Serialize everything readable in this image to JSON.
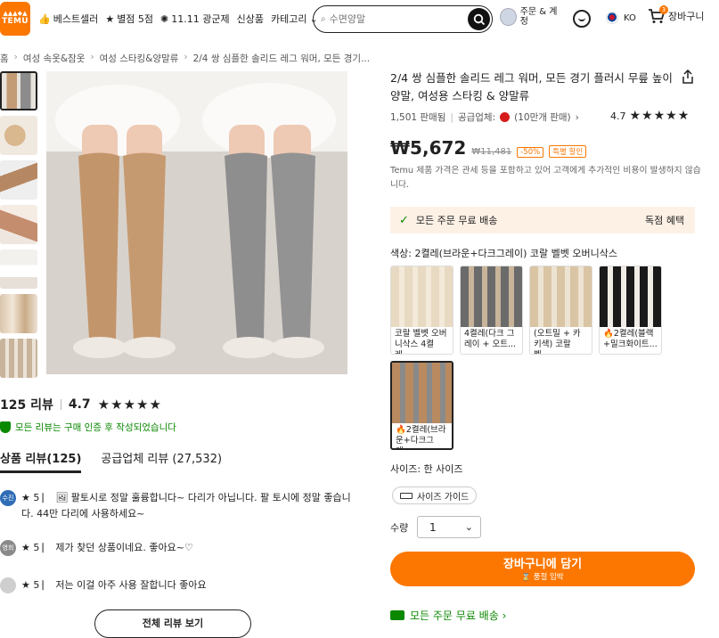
{
  "header": {
    "logo_line1": "▲▲▲◆▲",
    "logo_line2": "TEMU",
    "nav": [
      {
        "icon": "thumbs-up-icon",
        "glyph": "👍",
        "label": "베스트셀러"
      },
      {
        "icon": "star-badge-icon",
        "glyph": "★",
        "label": "별점 5점"
      },
      {
        "icon": "firework-icon",
        "glyph": "✺",
        "label": "11.11 광군제"
      },
      {
        "icon": "",
        "glyph": "",
        "label": "신상품"
      },
      {
        "icon": "chevron-down-icon",
        "glyph": "⌄",
        "label": "카테고리"
      }
    ],
    "search_placeholder": "수면양말",
    "account_label": "주문 & 계정",
    "lang": "KO",
    "cart_label": "장바구니",
    "cart_count": "3"
  },
  "breadcrumb": [
    "홈",
    "여성 속옷&잠옷",
    "여성 스타킹&양말류",
    "2/4 쌍 심플한 솔리드 레그 워머, 모든 경기..."
  ],
  "reviews": {
    "count_label": "125 리뷰",
    "rating": "4.7",
    "stars": "★★★★★",
    "verified": "모든 리뷰는 구매 인증 후 작성되었습니다",
    "tabs": [
      "상품 리뷰(125)",
      "공급업체 리뷰 (27,532)"
    ],
    "items": [
      {
        "avatar": "수진",
        "avatar_color": "#2f6db5",
        "text": "★ 5 ⎸ 🖼 팔토시로 정말 훌륭합니다~ 다리가 아닙니다. 팔 토시에 정말 좋습니다. 44만 다리에 사용하세요~"
      },
      {
        "avatar": "영희",
        "avatar_color": "#8a8a8a",
        "text": "★ 5 ⎸ 제가 찾던 상품이네요. 좋아요~♡"
      },
      {
        "avatar": "",
        "avatar_color": "#cfcfcf",
        "text": "★ 5 ⎸ 저는 이걸 아주 사용 잘합니다 좋아요"
      }
    ],
    "all_button": "전체 리뷰 보기"
  },
  "product": {
    "title": "2/4 쌍 심플한 솔리드 레그 워머, 모든 경기 플러시 무릎 높이 양말, 여성용 스타킹 & 양말류",
    "sold": "1,501 판매됨",
    "supplier_label": "공급업체:",
    "supplier_sales": "(10만개 판매)",
    "rating": "4.7",
    "stars": "★★★★★",
    "price": "₩5,672",
    "orig_price": "₩11,481",
    "discount": "-50%",
    "badge": "특별 할인",
    "price_note": "Temu 제품 가격은 관세 등을 포함하고 있어 고객에게 추가적인 비용이 발생하지 않습니다.",
    "shipping": "모든 주문 무료 배송",
    "shipping_extra": "독점 혜택",
    "color_label": "색상: 2켤레(브라운+다크그레이) 코랄 벨벳 오버니삭스",
    "swatches": [
      {
        "label": "코랄 벨벳 오버니삭스 4켤레...",
        "c1": "#e8d9c2",
        "c2": "#f3ead9",
        "selected": false
      },
      {
        "label": "4켤레(다크 그레이 + 오트...",
        "c1": "#6b6b6b",
        "c2": "#c8b49a",
        "selected": false
      },
      {
        "label": "(오트밀 + 카키색) 코랄 벨...",
        "c1": "#d9c4a4",
        "c2": "#ede3d2",
        "selected": false
      },
      {
        "label": "🔥2켤레(블랙+밀크화이트...",
        "c1": "#1a1a1a",
        "c2": "#f0ece6",
        "selected": false
      },
      {
        "label": "🔥2켤레(브라운+다크그레...",
        "c1": "#b98a5f",
        "c2": "#8a8a8a",
        "selected": true
      }
    ],
    "size_label": "사이즈: 한 사이즈",
    "size_guide": "사이즈 가이드",
    "qty_label": "수량",
    "qty_value": "1",
    "cart_button": "장바구니에 담기",
    "cart_button_sub": "⌛ 품절 임박",
    "free_shipping": "모든 주문 무료 배송 ›"
  }
}
